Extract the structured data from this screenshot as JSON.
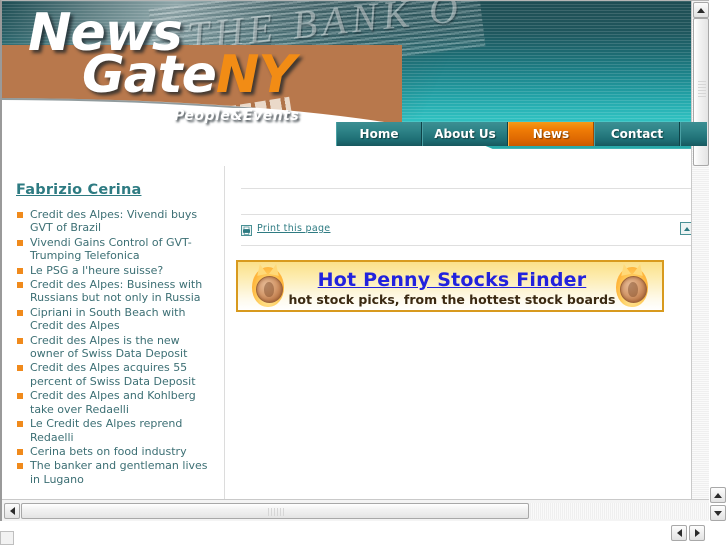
{
  "site": {
    "logo_line1": "News",
    "logo_line2_white": "Gate",
    "logo_line2_accent": "NY",
    "tagline": "People&Events",
    "header_bank_text": "THE BANK O"
  },
  "nav": {
    "items": [
      {
        "label": "Home",
        "active": false
      },
      {
        "label": "About Us",
        "active": false
      },
      {
        "label": "News",
        "active": true
      },
      {
        "label": "Contact",
        "active": false
      }
    ]
  },
  "sidebar": {
    "title": "Fabrizio Cerina",
    "items": [
      "Credit des Alpes: Vivendi buys GVT of Brazil",
      "Vivendi Gains Control of GVT-Trumping Telefonica",
      "Le PSG a l'heure suisse?",
      "Credit des Alpes: Business with Russians but not only in Russia",
      "Cipriani in South Beach with Credit des Alpes",
      "Credit des Alpes is the new owner of Swiss Data Deposit",
      "Credit des Alpes acquires 55 percent of Swiss Data Deposit",
      "Credit des Alpes and Kohlberg take over Redaelli",
      "Le Credit des Alpes reprend Redaelli",
      "Cerina bets on food industry",
      "The banker and gentleman lives in Lugano"
    ]
  },
  "main": {
    "print_label": "Print this page",
    "print_icon": "printer-icon",
    "back_to_top_icon": "triangle-up-icon",
    "banner": {
      "headline": "Hot Penny Stocks Finder",
      "subline": "hot stock picks, from the hottest stock boards",
      "left_icon": "flaming-penny-icon",
      "right_icon": "flaming-penny-icon"
    }
  },
  "colors": {
    "accent_orange": "#f08a1c",
    "nav_active": "#ef7d06",
    "teal": "#2e7b82",
    "link_blue": "#2222dd",
    "banner_border": "#d89a1e"
  },
  "scrollbars": {
    "vertical_up_icon": "arrow-up-icon",
    "vertical_down_icon": "arrow-down-icon",
    "horizontal_left_icon": "arrow-left-icon",
    "horizontal_right_icon": "arrow-right-icon"
  }
}
